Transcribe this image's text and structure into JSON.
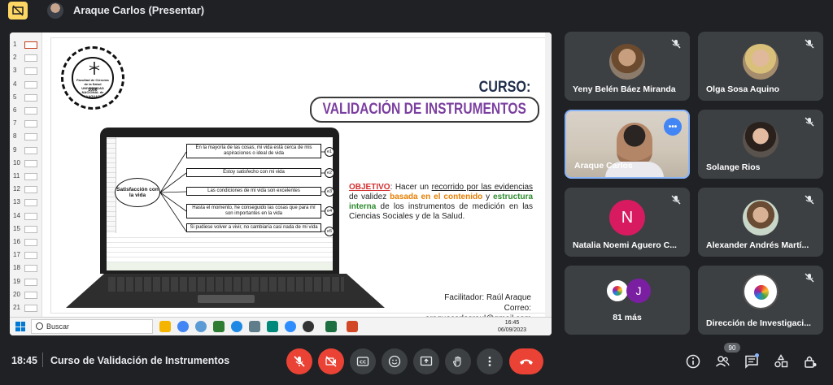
{
  "topbar": {
    "presenter_label": "Araque Carlos (Presentar)"
  },
  "slide": {
    "logo_text": "Facultad de Ciencias de la Salud UNIVERSIDAD NACIONAL de CAAGUAZÚ",
    "logo_year": "2006",
    "curso": "CURSO:",
    "title": "VALIDACIÓN DE INSTRUMENTOS",
    "diagram": {
      "construct": "Satisfacción con la vida",
      "items": [
        {
          "text": "En la mayoría de las cosas, mi vida está cerca de mis aspiraciones o ideal de vida",
          "err": "e1"
        },
        {
          "text": "Estoy satisfecho con mi vida",
          "err": "e2"
        },
        {
          "text": "Las condiciones de mi vida son excelentes",
          "err": "e3"
        },
        {
          "text": "Hasta el momento, he conseguido las cosas que para mí son importantes en la vida",
          "err": "e4"
        },
        {
          "text": "Si pudiese volver a vivir, no cambiaría casi nada de mi vida",
          "err": "e5"
        }
      ]
    },
    "objective": {
      "label": "OBJETIVO",
      "p1": ": Hacer un ",
      "u1": "recorrido por las evidencias",
      "p2": " de validez ",
      "orange": "basada en el contenido",
      "p3": " y ",
      "green": "estructura interna",
      "p4": " de los instrumentos de medición en las Ciencias Sociales y de la Salud."
    },
    "facilitator": "Facilitador: Raúl Araque",
    "email": "Correo: araquecarlosraul@gmail.com"
  },
  "slide_thumbs": [
    "1",
    "2",
    "3",
    "4",
    "5",
    "6",
    "7",
    "8",
    "9",
    "10",
    "11",
    "12",
    "13",
    "14",
    "15",
    "16",
    "17",
    "18",
    "19",
    "20",
    "21"
  ],
  "taskbar": {
    "search_placeholder": "Buscar",
    "time": "16:45",
    "date": "06/09/2023"
  },
  "participants": [
    {
      "name": "Yeny Belén Báez Miranda",
      "muted": true
    },
    {
      "name": "Olga Sosa Aquino",
      "muted": true
    },
    {
      "name": "Araque Carlos",
      "muted": false
    },
    {
      "name": "Solange Rios",
      "muted": true
    },
    {
      "name": "Natalia Noemi Aguero C...",
      "initial": "N",
      "muted": true
    },
    {
      "name": "Alexander Andrés Martí...",
      "muted": true
    },
    {
      "name": "81 más",
      "initial": "J"
    },
    {
      "name": "Dirección de Investigaci...",
      "muted": true
    }
  ],
  "bottom": {
    "clock": "18:45",
    "meeting_title": "Curso de Validación de Instrumentos",
    "participants_count": "90"
  },
  "colors": {
    "background": "#202124",
    "tile": "#3c4043",
    "danger": "#ea4335",
    "accent": "#8ab4f8",
    "title_purple": "#7b3fa0"
  }
}
